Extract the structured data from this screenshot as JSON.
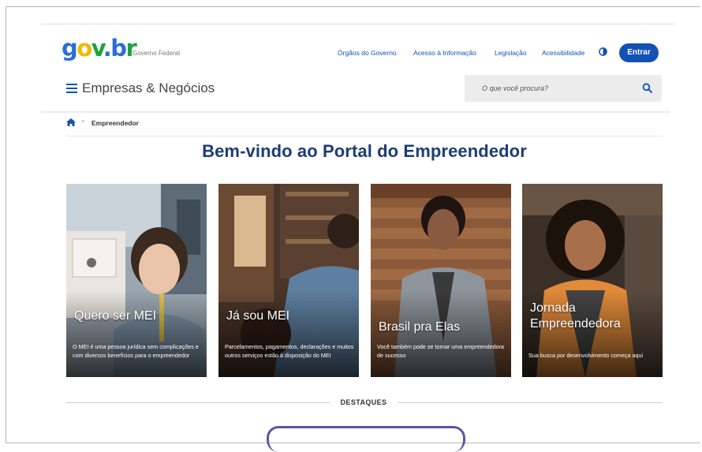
{
  "header": {
    "logo": {
      "g": "g",
      "o": "o",
      "v": "v",
      "dot": ".",
      "b": "b",
      "r": "r"
    },
    "gov_subtitle": "Governo Federal",
    "links": [
      "Órgãos do Governo",
      "Acesso à Informação",
      "Legislação",
      "Acessibilidade"
    ],
    "contrast_icon": "contrast-icon",
    "login_label": "Entrar",
    "site_title": "Empresas & Negócios",
    "search_placeholder": "O que você procura?"
  },
  "breadcrumb": {
    "separator": ">",
    "current": "Empreendedor"
  },
  "page_title": "Bem-vindo ao Portal do Empreendedor",
  "cards": [
    {
      "title": "Quero ser MEI",
      "description": "O MEI é uma pessoa jurídica sem complicações e com diversos benefícios para o empreendedor"
    },
    {
      "title": "Já sou MEI",
      "description": "Parcelamentos, pagamentos, declarações e muitos outros serviços estão à disposição do MEI"
    },
    {
      "title": "Brasil pra Elas",
      "description": "Você também pode se tornar uma empreendedora de sucesso"
    },
    {
      "title": "Jornada Empreendedora",
      "description": "Sua busca por desenvolvimento começa aqui"
    }
  ],
  "section_heading": "DESTAQUES",
  "colors": {
    "primary": "#1351b4",
    "title": "#1d3d73",
    "accent_purple": "#5a55a8"
  }
}
